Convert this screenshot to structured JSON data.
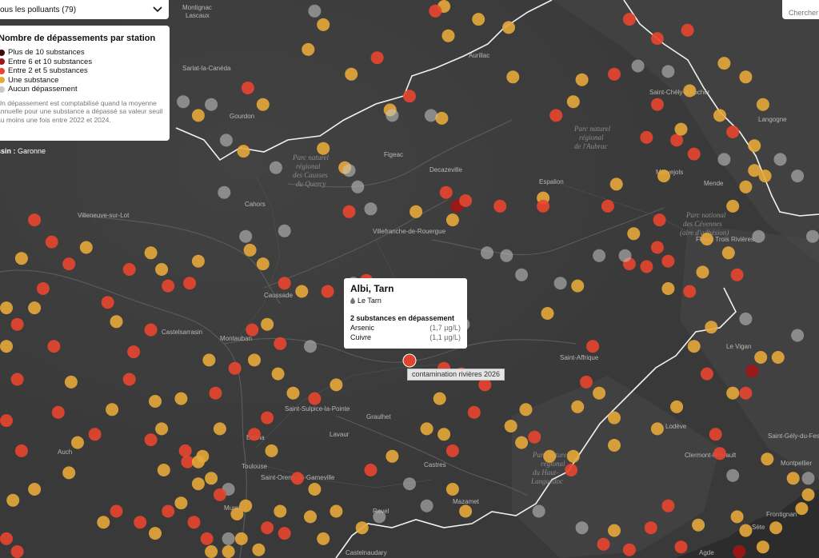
{
  "controls": {
    "pollutant_select_label": "ous les polluants (79)",
    "search_placeholder": "Chercher"
  },
  "legend": {
    "title": "Nombre de dépassements par station",
    "items": [
      {
        "label": "Plus de 10 substances",
        "color": "#3d0a0a"
      },
      {
        "label": "Entre 6 et 10 substances",
        "color": "#a31515"
      },
      {
        "label": "Entre 2 et 5 substances",
        "color": "#e8452e"
      },
      {
        "label": "Une substance",
        "color": "#e5a93a"
      },
      {
        "label": "Aucun dépassement",
        "color": "#c9c9c9"
      }
    ],
    "note": "Un dépassement est comptabilisé quand la moyenne annuelle pour une substance a dépassé sa valeur seuil au moins une fois entre 2022 et 2024."
  },
  "basin": {
    "label": "ssin :",
    "value": "Garonne"
  },
  "tooltip": {
    "title": "Albi, Tarn",
    "river": "Le Tarn",
    "river_icon": "water-drop-icon",
    "subtitle": "2 substances en dépassement",
    "rows": [
      {
        "name": "Arsenic",
        "value": "(1,7 µg/L)"
      },
      {
        "name": "Cuivre",
        "value": "(1,1 µg/L)"
      }
    ]
  },
  "map_label": "contamination rivières 2026",
  "places": [
    "Montignac",
    "Lascaux",
    "Sarlat-la-Canéda",
    "Aurillac",
    "Gourdon",
    "Saint-Chély-d'Apcher",
    "Langogne",
    "Figeac",
    "Decazeville",
    "Cahors",
    "Espalion",
    "Mende",
    "Marvejols",
    "Villeneuve-sur-Lot",
    "Villefranche-de-Rouergue",
    "Florac Trois Rivières",
    "Caussade",
    "Montauban",
    "Castelsarrasin",
    "Saint-Affrique",
    "Le Vigan",
    "Lodève",
    "Saint-Sulpice-la-Pointe",
    "Graulhet",
    "Lavaur",
    "Balma",
    "Toulouse",
    "Saint-Orens-de-Gameville",
    "Castres",
    "Mazamet",
    "Revel",
    "Muret",
    "Auch",
    "Clermont-l'Hérault",
    "Saint-Gély-du-Fesc",
    "Montpellier",
    "Frontignan",
    "Sète",
    "Castelnaudary",
    "Agde"
  ],
  "parks": [
    {
      "lines": [
        "Parc naturel",
        "régional",
        "des Causses",
        "du Quercy"
      ]
    },
    {
      "lines": [
        "Parc naturel",
        "régional",
        "de l'Aubrac"
      ]
    },
    {
      "lines": [
        "Parc national",
        "des Cévennes",
        "(aire d'adhésion)"
      ]
    },
    {
      "lines": [
        "Parc naturel",
        "régional",
        "du Haut-",
        "Languedoc"
      ]
    }
  ],
  "stations": [
    {
      "lon": 1.63,
      "lat": 44.8,
      "cat": 3
    },
    {
      "lon": 1.83,
      "lat": 44.71,
      "cat": 3
    },
    {
      "lon": 1.95,
      "lat": 44.77,
      "cat": 2
    },
    {
      "lon": 2.28,
      "lat": 44.85,
      "cat": 3
    },
    {
      "lon": 2.42,
      "lat": 44.91,
      "cat": 3
    },
    {
      "lon": 2.56,
      "lat": 44.88,
      "cat": 3
    },
    {
      "lon": 3.12,
      "lat": 44.91,
      "cat": 2
    },
    {
      "lon": 3.25,
      "lat": 44.84,
      "cat": 2
    },
    {
      "lon": 3.39,
      "lat": 44.87,
      "cat": 2
    },
    {
      "lon": 2.01,
      "lat": 44.58,
      "cat": 3
    },
    {
      "lon": 2.1,
      "lat": 44.63,
      "cat": 2
    },
    {
      "lon": 2.25,
      "lat": 44.55,
      "cat": 3
    },
    {
      "lon": 2.78,
      "lat": 44.56,
      "cat": 2
    },
    {
      "lon": 2.86,
      "lat": 44.61,
      "cat": 3
    },
    {
      "lon": 3.05,
      "lat": 44.71,
      "cat": 2
    },
    {
      "lon": 3.25,
      "lat": 44.6,
      "cat": 2
    },
    {
      "lon": 3.4,
      "lat": 44.65,
      "cat": 3
    },
    {
      "lon": 3.54,
      "lat": 44.56,
      "cat": 3
    },
    {
      "lon": 1.35,
      "lat": 44.66,
      "cat": 2
    },
    {
      "lon": 1.42,
      "lat": 44.6,
      "cat": 3
    },
    {
      "lon": 1.12,
      "lat": 44.56,
      "cat": 3
    },
    {
      "lon": 1.18,
      "lat": 44.6,
      "cat": 4
    },
    {
      "lon": 1.05,
      "lat": 44.61,
      "cat": 4
    },
    {
      "lon": 1.25,
      "lat": 44.47,
      "cat": 4
    },
    {
      "lon": 1.33,
      "lat": 44.43,
      "cat": 3
    },
    {
      "lon": 1.48,
      "lat": 44.37,
      "cat": 4
    },
    {
      "lon": 1.7,
      "lat": 44.44,
      "cat": 3
    },
    {
      "lon": 1.8,
      "lat": 44.37,
      "cat": 3
    },
    {
      "lon": 1.82,
      "lat": 44.21,
      "cat": 2
    },
    {
      "lon": 1.92,
      "lat": 44.22,
      "cat": 4
    },
    {
      "lon": 2.13,
      "lat": 44.21,
      "cat": 3
    },
    {
      "lon": 2.2,
      "lat": 44.56,
      "cat": 4
    },
    {
      "lon": 2.27,
      "lat": 44.28,
      "cat": 2
    },
    {
      "lon": 2.32,
      "lat": 44.23,
      "cat": 1
    },
    {
      "lon": 2.36,
      "lat": 44.25,
      "cat": 2
    },
    {
      "lon": 2.3,
      "lat": 44.18,
      "cat": 3
    },
    {
      "lon": 2.52,
      "lat": 44.23,
      "cat": 2
    },
    {
      "lon": 2.72,
      "lat": 44.26,
      "cat": 3
    },
    {
      "lon": 2.72,
      "lat": 44.23,
      "cat": 2
    },
    {
      "lon": 3.02,
      "lat": 44.23,
      "cat": 2
    },
    {
      "lon": 3.14,
      "lat": 44.13,
      "cat": 3
    },
    {
      "lon": 3.25,
      "lat": 44.08,
      "cat": 2
    },
    {
      "lon": 3.3,
      "lat": 44.03,
      "cat": 2
    },
    {
      "lon": 3.48,
      "lat": 44.11,
      "cat": 3
    },
    {
      "lon": 3.58,
      "lat": 44.06,
      "cat": 3
    },
    {
      "lon": 3.62,
      "lat": 43.98,
      "cat": 2
    },
    {
      "lon": 3.72,
      "lat": 44.12,
      "cat": 4
    },
    {
      "lon": 3.66,
      "lat": 44.3,
      "cat": 3
    },
    {
      "lon": 3.7,
      "lat": 44.45,
      "cat": 3
    },
    {
      "lon": 3.66,
      "lat": 44.7,
      "cat": 3
    },
    {
      "lon": 3.56,
      "lat": 44.4,
      "cat": 4
    },
    {
      "lon": 3.42,
      "lat": 44.42,
      "cat": 2
    },
    {
      "lon": 3.34,
      "lat": 44.47,
      "cat": 2
    },
    {
      "lon": 3.36,
      "lat": 44.51,
      "cat": 3
    },
    {
      "lon": 3.6,
      "lat": 44.5,
      "cat": 2
    },
    {
      "lon": 3.7,
      "lat": 44.36,
      "cat": 3
    },
    {
      "lon": 3.75,
      "lat": 44.34,
      "cat": 3
    },
    {
      "lon": 3.2,
      "lat": 44.48,
      "cat": 2
    },
    {
      "lon": 3.06,
      "lat": 44.31,
      "cat": 3
    },
    {
      "lon": 3.28,
      "lat": 44.34,
      "cat": 3
    },
    {
      "lon": 3.26,
      "lat": 44.18,
      "cat": 2
    },
    {
      "lon": 3.12,
      "lat": 44.02,
      "cat": 2
    },
    {
      "lon": 3.2,
      "lat": 44.01,
      "cat": 2
    },
    {
      "lon": 3.3,
      "lat": 43.93,
      "cat": 3
    },
    {
      "lon": 3.4,
      "lat": 43.92,
      "cat": 2
    },
    {
      "lon": 3.46,
      "lat": 43.99,
      "cat": 3
    },
    {
      "lon": 3.42,
      "lat": 43.72,
      "cat": 3
    },
    {
      "lon": 3.5,
      "lat": 43.79,
      "cat": 3
    },
    {
      "lon": 3.48,
      "lat": 43.62,
      "cat": 2
    },
    {
      "lon": 3.6,
      "lat": 43.55,
      "cat": 3
    },
    {
      "lon": 3.69,
      "lat": 43.63,
      "cat": 1
    },
    {
      "lon": 3.66,
      "lat": 43.55,
      "cat": 2
    },
    {
      "lon": 3.81,
      "lat": 43.68,
      "cat": 3
    },
    {
      "lon": 3.73,
      "lat": 43.68,
      "cat": 3
    },
    {
      "lon": 3.52,
      "lat": 43.4,
      "cat": 2
    },
    {
      "lon": 3.54,
      "lat": 43.33,
      "cat": 2
    },
    {
      "lon": 3.34,
      "lat": 43.5,
      "cat": 3
    },
    {
      "lon": 3.25,
      "lat": 43.42,
      "cat": 3
    },
    {
      "lon": 3.44,
      "lat": 43.07,
      "cat": 3
    },
    {
      "lon": 3.62,
      "lat": 43.1,
      "cat": 3
    },
    {
      "lon": 3.66,
      "lat": 43.05,
      "cat": 3
    },
    {
      "lon": 3.3,
      "lat": 43.14,
      "cat": 2
    },
    {
      "lon": 3.22,
      "lat": 43.06,
      "cat": 2
    },
    {
      "lon": 3.12,
      "lat": 42.98,
      "cat": 2
    },
    {
      "lon": 3.05,
      "lat": 43.05,
      "cat": 3
    },
    {
      "lon": 3.0,
      "lat": 43.0,
      "cat": 2
    },
    {
      "lon": 3.36,
      "lat": 42.99,
      "cat": 2
    },
    {
      "lon": 3.63,
      "lat": 42.97,
      "cat": 1
    },
    {
      "lon": 3.74,
      "lat": 42.99,
      "cat": 3
    },
    {
      "lon": 3.8,
      "lat": 43.06,
      "cat": 3
    },
    {
      "lon": 3.92,
      "lat": 43.13,
      "cat": 3
    },
    {
      "lon": 3.95,
      "lat": 43.18,
      "cat": 3
    },
    {
      "lon": 3.88,
      "lat": 43.24,
      "cat": 3
    },
    {
      "lon": 3.6,
      "lat": 43.25,
      "cat": 4
    },
    {
      "lon": 3.76,
      "lat": 43.31,
      "cat": 3
    },
    {
      "lon": 3.98,
      "lat": 44.96,
      "cat": 4
    },
    {
      "lon": 3.6,
      "lat": 44.23,
      "cat": 3
    },
    {
      "lon": 2.88,
      "lat": 43.94,
      "cat": 3
    },
    {
      "lon": 2.74,
      "lat": 43.84,
      "cat": 3
    },
    {
      "lon": 2.95,
      "lat": 43.72,
      "cat": 2
    },
    {
      "lon": 2.92,
      "lat": 43.59,
      "cat": 2
    },
    {
      "lon": 2.98,
      "lat": 43.55,
      "cat": 3
    },
    {
      "lon": 2.88,
      "lat": 43.5,
      "cat": 3
    },
    {
      "lon": 3.05,
      "lat": 43.46,
      "cat": 3
    },
    {
      "lon": 3.05,
      "lat": 43.36,
      "cat": 3
    },
    {
      "lon": 2.86,
      "lat": 43.32,
      "cat": 3
    },
    {
      "lon": 2.85,
      "lat": 43.27,
      "cat": 2
    },
    {
      "lon": 2.75,
      "lat": 43.32,
      "cat": 3
    },
    {
      "lon": 2.68,
      "lat": 43.39,
      "cat": 2
    },
    {
      "lon": 2.62,
      "lat": 43.37,
      "cat": 3
    },
    {
      "lon": 2.57,
      "lat": 43.43,
      "cat": 3
    },
    {
      "lon": 2.64,
      "lat": 43.49,
      "cat": 3
    },
    {
      "lon": 2.4,
      "lat": 43.48,
      "cat": 2
    },
    {
      "lon": 2.45,
      "lat": 43.58,
      "cat": 2
    },
    {
      "lon": 2.34,
      "lat": 43.62,
      "cat": 2
    },
    {
      "lon": 2.26,
      "lat": 43.64,
      "cat": 2
    },
    {
      "lon": 2.24,
      "lat": 43.53,
      "cat": 3
    },
    {
      "lon": 2.18,
      "lat": 43.42,
      "cat": 3
    },
    {
      "lon": 2.26,
      "lat": 43.4,
      "cat": 3
    },
    {
      "lon": 2.3,
      "lat": 43.34,
      "cat": 2
    },
    {
      "lon": 2.3,
      "lat": 43.2,
      "cat": 3
    },
    {
      "lon": 2.36,
      "lat": 43.12,
      "cat": 3
    },
    {
      "lon": 2.1,
      "lat": 43.22,
      "cat": 4
    },
    {
      "lon": 2.02,
      "lat": 43.32,
      "cat": 3
    },
    {
      "lon": 1.92,
      "lat": 43.27,
      "cat": 2
    },
    {
      "lon": 1.88,
      "lat": 43.06,
      "cat": 3
    },
    {
      "lon": 1.7,
      "lat": 43.02,
      "cat": 3
    },
    {
      "lon": 1.64,
      "lat": 43.1,
      "cat": 3
    },
    {
      "lon": 1.76,
      "lat": 43.12,
      "cat": 3
    },
    {
      "lon": 1.66,
      "lat": 43.2,
      "cat": 3
    },
    {
      "lon": 1.58,
      "lat": 43.24,
      "cat": 2
    },
    {
      "lon": 1.46,
      "lat": 43.34,
      "cat": 3
    },
    {
      "lon": 1.38,
      "lat": 43.4,
      "cat": 2
    },
    {
      "lon": 1.44,
      "lat": 43.46,
      "cat": 2
    },
    {
      "lon": 1.22,
      "lat": 43.42,
      "cat": 3
    },
    {
      "lon": 1.07,
      "lat": 43.3,
      "cat": 2
    },
    {
      "lon": 0.95,
      "lat": 43.42,
      "cat": 3
    },
    {
      "lon": 0.92,
      "lat": 43.52,
      "cat": 3
    },
    {
      "lon": 0.8,
      "lat": 43.6,
      "cat": 2
    },
    {
      "lon": 0.72,
      "lat": 43.49,
      "cat": 3
    },
    {
      "lon": 0.64,
      "lat": 43.4,
      "cat": 2
    },
    {
      "lon": 0.53,
      "lat": 43.59,
      "cat": 3
    },
    {
      "lon": 0.56,
      "lat": 43.37,
      "cat": 3
    },
    {
      "lon": 0.47,
      "lat": 43.48,
      "cat": 2
    },
    {
      "lon": 1.06,
      "lat": 43.34,
      "cat": 2
    },
    {
      "lon": 1.14,
      "lat": 43.32,
      "cat": 3
    },
    {
      "lon": 1.04,
      "lat": 43.53,
      "cat": 3
    },
    {
      "lon": 1.2,
      "lat": 43.55,
      "cat": 2
    },
    {
      "lon": 1.17,
      "lat": 43.67,
      "cat": 3
    },
    {
      "lon": 1.29,
      "lat": 43.64,
      "cat": 2
    },
    {
      "lon": 1.38,
      "lat": 43.67,
      "cat": 3
    },
    {
      "lon": 1.37,
      "lat": 43.78,
      "cat": 2
    },
    {
      "lon": 1.44,
      "lat": 43.8,
      "cat": 3
    },
    {
      "lon": 1.5,
      "lat": 43.73,
      "cat": 2
    },
    {
      "lon": 1.49,
      "lat": 43.62,
      "cat": 3
    },
    {
      "lon": 1.56,
      "lat": 43.55,
      "cat": 3
    },
    {
      "lon": 1.66,
      "lat": 43.53,
      "cat": 2
    },
    {
      "lon": 1.76,
      "lat": 43.58,
      "cat": 3
    },
    {
      "lon": 1.6,
      "lat": 43.92,
      "cat": 3
    },
    {
      "lon": 1.72,
      "lat": 43.92,
      "cat": 2
    },
    {
      "lon": 1.84,
      "lat": 43.95,
      "cat": 4
    },
    {
      "lon": 1.9,
      "lat": 43.96,
      "cat": 2
    },
    {
      "lon": 1.52,
      "lat": 43.95,
      "cat": 2
    },
    {
      "lon": 1.42,
      "lat": 44.02,
      "cat": 3
    },
    {
      "lon": 1.36,
      "lat": 44.07,
      "cat": 3
    },
    {
      "lon": 1.34,
      "lat": 44.12,
      "cat": 4
    },
    {
      "lon": 1.12,
      "lat": 44.03,
      "cat": 3
    },
    {
      "lon": 1.08,
      "lat": 43.95,
      "cat": 2
    },
    {
      "lon": 0.98,
      "lat": 43.94,
      "cat": 2
    },
    {
      "lon": 0.95,
      "lat": 44.0,
      "cat": 3
    },
    {
      "lon": 0.9,
      "lat": 44.06,
      "cat": 3
    },
    {
      "lon": 0.8,
      "lat": 44.0,
      "cat": 2
    },
    {
      "lon": 0.7,
      "lat": 43.88,
      "cat": 2
    },
    {
      "lon": 0.74,
      "lat": 43.81,
      "cat": 3
    },
    {
      "lon": 0.9,
      "lat": 43.78,
      "cat": 2
    },
    {
      "lon": 0.82,
      "lat": 43.7,
      "cat": 2
    },
    {
      "lon": 0.6,
      "lat": 44.08,
      "cat": 3
    },
    {
      "lon": 0.52,
      "lat": 44.02,
      "cat": 2
    },
    {
      "lon": 0.44,
      "lat": 44.1,
      "cat": 2
    },
    {
      "lon": 0.36,
      "lat": 44.18,
      "cat": 2
    },
    {
      "lon": 0.3,
      "lat": 44.04,
      "cat": 3
    },
    {
      "lon": 0.36,
      "lat": 43.86,
      "cat": 3
    },
    {
      "lon": 0.4,
      "lat": 43.93,
      "cat": 2
    },
    {
      "lon": 0.22,
      "lat": 43.86,
      "cat": 3
    },
    {
      "lon": 0.28,
      "lat": 43.8,
      "cat": 2
    },
    {
      "lon": 0.45,
      "lat": 43.72,
      "cat": 2
    },
    {
      "lon": 0.2,
      "lat": 43.72,
      "cat": 3
    },
    {
      "lon": 0.28,
      "lat": 43.6,
      "cat": 2
    },
    {
      "lon": 0.22,
      "lat": 43.45,
      "cat": 2
    },
    {
      "lon": 0.52,
      "lat": 43.26,
      "cat": 3
    },
    {
      "lon": 0.3,
      "lat": 43.34,
      "cat": 2
    },
    {
      "lon": 0.36,
      "lat": 43.2,
      "cat": 3
    },
    {
      "lon": 0.26,
      "lat": 43.16,
      "cat": 3
    },
    {
      "lon": 0.22,
      "lat": 43.02,
      "cat": 2
    },
    {
      "lon": 0.28,
      "lat": 42.96,
      "cat": 2
    },
    {
      "lon": 0.68,
      "lat": 43.08,
      "cat": 3
    },
    {
      "lon": 0.74,
      "lat": 43.12,
      "cat": 2
    },
    {
      "lon": 0.85,
      "lat": 43.08,
      "cat": 2
    },
    {
      "lon": 0.92,
      "lat": 43.04,
      "cat": 3
    },
    {
      "lon": 0.98,
      "lat": 43.12,
      "cat": 2
    },
    {
      "lon": 1.04,
      "lat": 43.15,
      "cat": 3
    },
    {
      "lon": 1.1,
      "lat": 43.08,
      "cat": 2
    },
    {
      "lon": 1.16,
      "lat": 43.02,
      "cat": 2
    },
    {
      "lon": 1.18,
      "lat": 42.96,
      "cat": 3
    },
    {
      "lon": 1.26,
      "lat": 42.97,
      "cat": 3
    },
    {
      "lon": 1.32,
      "lat": 43.02,
      "cat": 3
    },
    {
      "lon": 1.4,
      "lat": 42.98,
      "cat": 3
    },
    {
      "lon": 1.44,
      "lat": 43.06,
      "cat": 2
    },
    {
      "lon": 1.5,
      "lat": 43.12,
      "cat": 3
    },
    {
      "lon": 1.52,
      "lat": 43.04,
      "cat": 2
    },
    {
      "lon": 1.12,
      "lat": 43.22,
      "cat": 3
    },
    {
      "lon": 1.26,
      "lat": 43.2,
      "cat": 4
    },
    {
      "lon": 1.18,
      "lat": 43.24,
      "cat": 3
    },
    {
      "lon": 1.22,
      "lat": 43.18,
      "cat": 2
    },
    {
      "lon": 1.3,
      "lat": 43.11,
      "cat": 3
    },
    {
      "lon": 1.34,
      "lat": 43.14,
      "cat": 3
    },
    {
      "lon": 0.96,
      "lat": 43.27,
      "cat": 3
    },
    {
      "lon": 0.9,
      "lat": 43.38,
      "cat": 2
    },
    {
      "lon": 1.12,
      "lat": 43.3,
      "cat": 3
    },
    {
      "lon": 1.24,
      "lat": 44.28,
      "cat": 4
    },
    {
      "lon": 1.52,
      "lat": 44.14,
      "cat": 4
    },
    {
      "lon": 1.82,
      "lat": 44.36,
      "cat": 4
    },
    {
      "lon": 1.86,
      "lat": 44.3,
      "cat": 4
    },
    {
      "lon": 2.02,
      "lat": 44.56,
      "cat": 4
    },
    {
      "lon": 2.55,
      "lat": 44.05,
      "cat": 4
    },
    {
      "lon": 2.62,
      "lat": 43.98,
      "cat": 4
    },
    {
      "lon": 2.8,
      "lat": 43.95,
      "cat": 4
    },
    {
      "lon": 2.98,
      "lat": 44.05,
      "cat": 4
    },
    {
      "lon": 3.1,
      "lat": 44.05,
      "cat": 4
    },
    {
      "lon": 2.46,
      "lat": 44.06,
      "cat": 4
    },
    {
      "lon": 2.35,
      "lat": 43.8,
      "cat": 4
    },
    {
      "lon": 2.12,
      "lat": 43.75,
      "cat": 4
    },
    {
      "lon": 1.98,
      "lat": 43.88,
      "cat": 4
    },
    {
      "lon": 1.64,
      "lat": 43.72,
      "cat": 4
    },
    {
      "lon": 1.26,
      "lat": 43.02,
      "cat": 4
    },
    {
      "lon": 1.96,
      "lat": 43.1,
      "cat": 4
    },
    {
      "lon": 2.18,
      "lat": 43.14,
      "cat": 4
    },
    {
      "lon": 2.7,
      "lat": 43.12,
      "cat": 4
    },
    {
      "lon": 2.9,
      "lat": 43.06,
      "cat": 4
    },
    {
      "lon": 3.16,
      "lat": 44.74,
      "cat": 4
    },
    {
      "lon": 3.3,
      "lat": 44.72,
      "cat": 4
    },
    {
      "lon": 3.82,
      "lat": 44.4,
      "cat": 4
    },
    {
      "lon": 3.9,
      "lat": 44.34,
      "cat": 4
    },
    {
      "lon": 3.98,
      "lat": 44.12,
      "cat": 4
    },
    {
      "lon": 3.66,
      "lat": 43.82,
      "cat": 4
    },
    {
      "lon": 3.9,
      "lat": 43.76,
      "cat": 4
    },
    {
      "lon": 3.95,
      "lat": 43.24,
      "cat": 4
    },
    {
      "lon": 1.66,
      "lat": 44.94,
      "cat": 4
    },
    {
      "lon": 1.7,
      "lat": 44.89,
      "cat": 3
    },
    {
      "lon": 2.26,
      "lat": 44.98,
      "cat": 3
    },
    {
      "lon": 2.22,
      "lat": 44.94,
      "cat": 2
    },
    {
      "lon": 2.9,
      "lat": 44.69,
      "cat": 3
    },
    {
      "lon": 2.58,
      "lat": 44.7,
      "cat": 3
    },
    {
      "lon": 3.56,
      "lat": 44.75,
      "cat": 3
    },
    {
      "lon": 3.74,
      "lat": 44.6,
      "cat": 3
    }
  ]
}
